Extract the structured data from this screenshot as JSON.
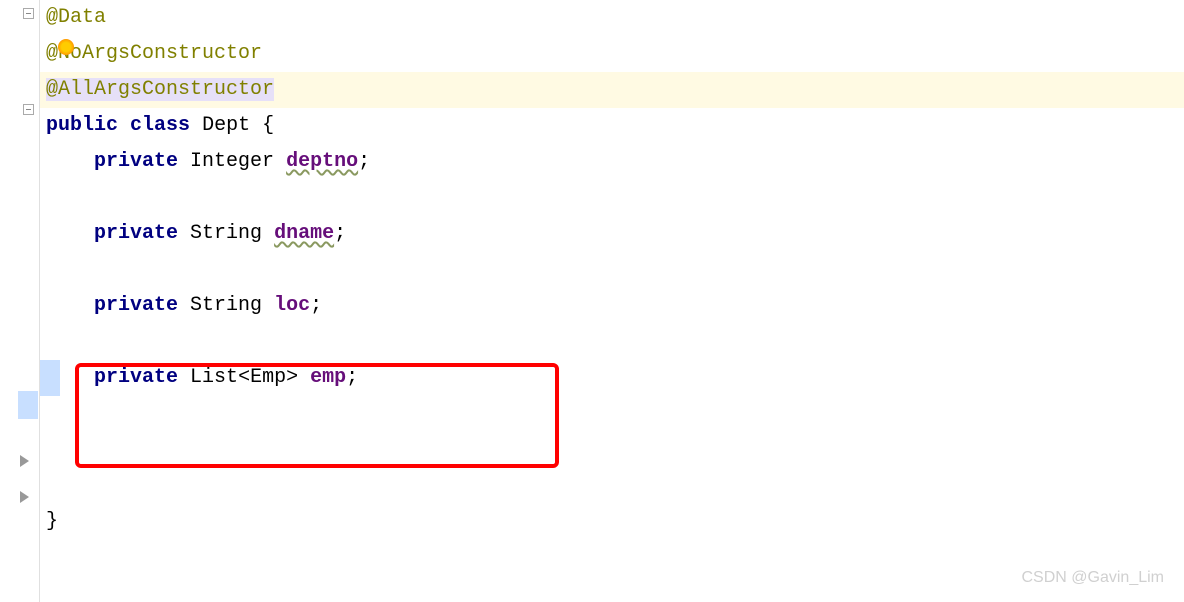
{
  "code": {
    "annotation_data": "@Data",
    "annotation_noargs": "@NoArgsConstructor",
    "annotation_allargs": "@AllArgsConstructor",
    "kw_public": "public",
    "kw_class": "class",
    "classname": "Dept",
    "open_brace": " {",
    "kw_private": "private",
    "type_integer": "Integer",
    "field_deptno": "deptno",
    "type_string": "String",
    "field_dname": "dname",
    "field_loc": "loc",
    "type_list": "List",
    "generic_emp": "<Emp>",
    "field_emp": "emp",
    "semicolon": ";",
    "close_brace": "}"
  },
  "watermark": "CSDN @Gavin_Lim"
}
